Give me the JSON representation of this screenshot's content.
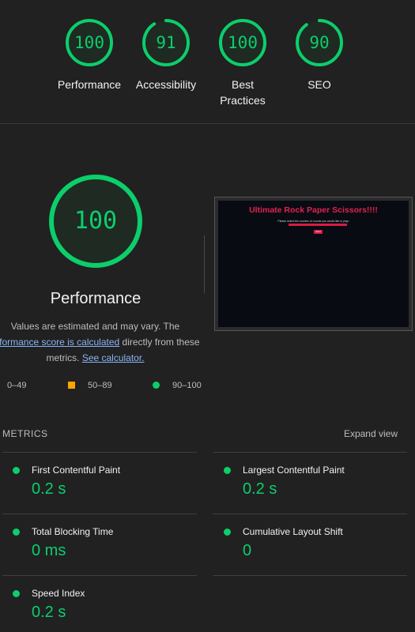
{
  "categories": [
    {
      "id": "performance",
      "label": "Performance",
      "score": "100",
      "value": 100
    },
    {
      "id": "accessibility",
      "label": "Accessibility",
      "score": "91",
      "value": 91
    },
    {
      "id": "best-practices",
      "label": "Best Practices",
      "score": "100",
      "value": 100
    },
    {
      "id": "seo",
      "label": "SEO",
      "score": "90",
      "value": 90
    }
  ],
  "performance": {
    "score": "100",
    "value": 100,
    "title": "Performance",
    "desc_prefix": "Values are estimated and may vary. The ",
    "desc_link": "erformance score is calculated",
    "desc_mid": " directly from these metrics. ",
    "desc_link2": "See calculator."
  },
  "legend": [
    {
      "range": "0–49",
      "color": "#ff4e42"
    },
    {
      "range": "50–89",
      "color": "#ffa400"
    },
    {
      "range": "90–100",
      "color": "#0cce6b"
    }
  ],
  "thumbnail": {
    "title": "Ultimate Rock Paper Scissors!!!!",
    "subtitle": "Please select the number of rounds you would like to play:",
    "button": "Start"
  },
  "metrics": {
    "header": "METRICS",
    "expand": "Expand view",
    "items": [
      {
        "label": "First Contentful Paint",
        "value": "0.2 s"
      },
      {
        "label": "Largest Contentful Paint",
        "value": "0.2 s"
      },
      {
        "label": "Total Blocking Time",
        "value": "0 ms"
      },
      {
        "label": "Cumulative Layout Shift",
        "value": "0"
      },
      {
        "label": "Speed Index",
        "value": "0.2 s"
      }
    ]
  },
  "colors": {
    "pass": "#0cce6b",
    "average": "#ffa400",
    "fail": "#ff4e42",
    "link": "#8ab4f8"
  }
}
